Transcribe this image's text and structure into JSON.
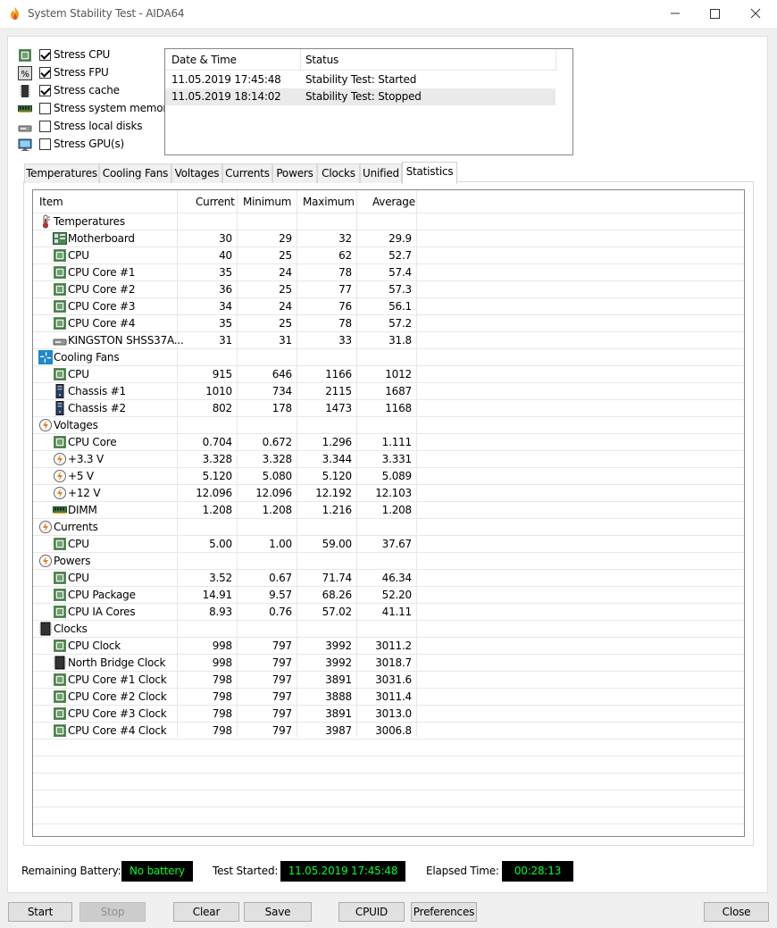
{
  "window": {
    "title": "System Stability Test - AIDA64"
  },
  "options": [
    {
      "label": "Stress CPU",
      "checked": true,
      "icon": "cpu-chip-icon"
    },
    {
      "label": "Stress FPU",
      "checked": true,
      "icon": "fpu-icon"
    },
    {
      "label": "Stress cache",
      "checked": true,
      "icon": "cache-icon"
    },
    {
      "label": "Stress system memory",
      "checked": false,
      "icon": "memory-icon"
    },
    {
      "label": "Stress local disks",
      "checked": false,
      "icon": "disk-icon"
    },
    {
      "label": "Stress GPU(s)",
      "checked": false,
      "icon": "gpu-icon"
    }
  ],
  "log": {
    "columns": [
      "Date & Time",
      "Status"
    ],
    "rows": [
      {
        "time": "11.05.2019 17:45:48",
        "status": "Stability Test: Started"
      },
      {
        "time": "11.05.2019 18:14:02",
        "status": "Stability Test: Stopped"
      }
    ]
  },
  "tabs": [
    "Temperatures",
    "Cooling Fans",
    "Voltages",
    "Currents",
    "Powers",
    "Clocks",
    "Unified",
    "Statistics"
  ],
  "active_tab": "Statistics",
  "stats": {
    "columns": [
      "Item",
      "Current",
      "Minimum",
      "Maximum",
      "Average"
    ],
    "rows": [
      {
        "group": true,
        "name": "Temperatures",
        "icon": "thermometer-icon"
      },
      {
        "name": "Motherboard",
        "icon": "motherboard-icon",
        "cur": "30",
        "min": "29",
        "max": "32",
        "avg": "29.9"
      },
      {
        "name": "CPU",
        "icon": "cpu-chip-icon",
        "cur": "40",
        "min": "25",
        "max": "62",
        "avg": "52.7"
      },
      {
        "name": "CPU Core #1",
        "icon": "cpu-chip-icon",
        "cur": "35",
        "min": "24",
        "max": "78",
        "avg": "57.4"
      },
      {
        "name": "CPU Core #2",
        "icon": "cpu-chip-icon",
        "cur": "36",
        "min": "25",
        "max": "77",
        "avg": "57.3"
      },
      {
        "name": "CPU Core #3",
        "icon": "cpu-chip-icon",
        "cur": "34",
        "min": "24",
        "max": "76",
        "avg": "56.1"
      },
      {
        "name": "CPU Core #4",
        "icon": "cpu-chip-icon",
        "cur": "35",
        "min": "25",
        "max": "78",
        "avg": "57.2"
      },
      {
        "name": "KINGSTON SHSS37A...",
        "icon": "disk-icon",
        "cur": "31",
        "min": "31",
        "max": "33",
        "avg": "31.8"
      },
      {
        "group": true,
        "name": "Cooling Fans",
        "icon": "fan-icon"
      },
      {
        "name": "CPU",
        "icon": "cpu-chip-icon",
        "cur": "915",
        "min": "646",
        "max": "1166",
        "avg": "1012"
      },
      {
        "name": "Chassis #1",
        "icon": "chassis-icon",
        "cur": "1010",
        "min": "734",
        "max": "2115",
        "avg": "1687"
      },
      {
        "name": "Chassis #2",
        "icon": "chassis-icon",
        "cur": "802",
        "min": "178",
        "max": "1473",
        "avg": "1168"
      },
      {
        "group": true,
        "name": "Voltages",
        "icon": "lightning-icon"
      },
      {
        "name": "CPU Core",
        "icon": "cpu-chip-icon",
        "cur": "0.704",
        "min": "0.672",
        "max": "1.296",
        "avg": "1.111"
      },
      {
        "name": "+3.3 V",
        "icon": "lightning-icon",
        "cur": "3.328",
        "min": "3.328",
        "max": "3.344",
        "avg": "3.331"
      },
      {
        "name": "+5 V",
        "icon": "lightning-icon",
        "cur": "5.120",
        "min": "5.080",
        "max": "5.120",
        "avg": "5.089"
      },
      {
        "name": "+12 V",
        "icon": "lightning-icon",
        "cur": "12.096",
        "min": "12.096",
        "max": "12.192",
        "avg": "12.103"
      },
      {
        "name": "DIMM",
        "icon": "memory-icon",
        "cur": "1.208",
        "min": "1.208",
        "max": "1.216",
        "avg": "1.208"
      },
      {
        "group": true,
        "name": "Currents",
        "icon": "lightning-icon"
      },
      {
        "name": "CPU",
        "icon": "cpu-chip-icon",
        "cur": "5.00",
        "min": "1.00",
        "max": "59.00",
        "avg": "37.67"
      },
      {
        "group": true,
        "name": "Powers",
        "icon": "lightning-icon"
      },
      {
        "name": "CPU",
        "icon": "cpu-chip-icon",
        "cur": "3.52",
        "min": "0.67",
        "max": "71.74",
        "avg": "46.34"
      },
      {
        "name": "CPU Package",
        "icon": "cpu-chip-icon",
        "cur": "14.91",
        "min": "9.57",
        "max": "68.26",
        "avg": "52.20"
      },
      {
        "name": "CPU IA Cores",
        "icon": "cpu-chip-icon",
        "cur": "8.93",
        "min": "0.76",
        "max": "57.02",
        "avg": "41.11"
      },
      {
        "group": true,
        "name": "Clocks",
        "icon": "clock-chip-icon"
      },
      {
        "name": "CPU Clock",
        "icon": "cpu-chip-icon",
        "cur": "998",
        "min": "797",
        "max": "3992",
        "avg": "3011.2"
      },
      {
        "name": "North Bridge Clock",
        "icon": "clock-chip-icon",
        "cur": "998",
        "min": "797",
        "max": "3992",
        "avg": "3018.7"
      },
      {
        "name": "CPU Core #1 Clock",
        "icon": "cpu-chip-icon",
        "cur": "798",
        "min": "797",
        "max": "3891",
        "avg": "3031.6"
      },
      {
        "name": "CPU Core #2 Clock",
        "icon": "cpu-chip-icon",
        "cur": "798",
        "min": "797",
        "max": "3888",
        "avg": "3011.4"
      },
      {
        "name": "CPU Core #3 Clock",
        "icon": "cpu-chip-icon",
        "cur": "798",
        "min": "797",
        "max": "3891",
        "avg": "3013.0"
      },
      {
        "name": "CPU Core #4 Clock",
        "icon": "cpu-chip-icon",
        "cur": "798",
        "min": "797",
        "max": "3987",
        "avg": "3006.8"
      }
    ]
  },
  "status": {
    "battery_label": "Remaining Battery:",
    "battery_value": "No battery",
    "started_label": "Test Started:",
    "started_value": "11.05.2019 17:45:48",
    "elapsed_label": "Elapsed Time:",
    "elapsed_value": "00:28:13"
  },
  "buttons": {
    "start": "Start",
    "stop": "Stop",
    "clear": "Clear",
    "save": "Save",
    "cpuid": "CPUID",
    "preferences": "Preferences",
    "close": "Close"
  },
  "colors": {
    "lcd_bg": "#000000",
    "lcd_text": "#00ff2a",
    "chip_green": "#2f7a3a",
    "accent_orange": "#e67e22"
  }
}
